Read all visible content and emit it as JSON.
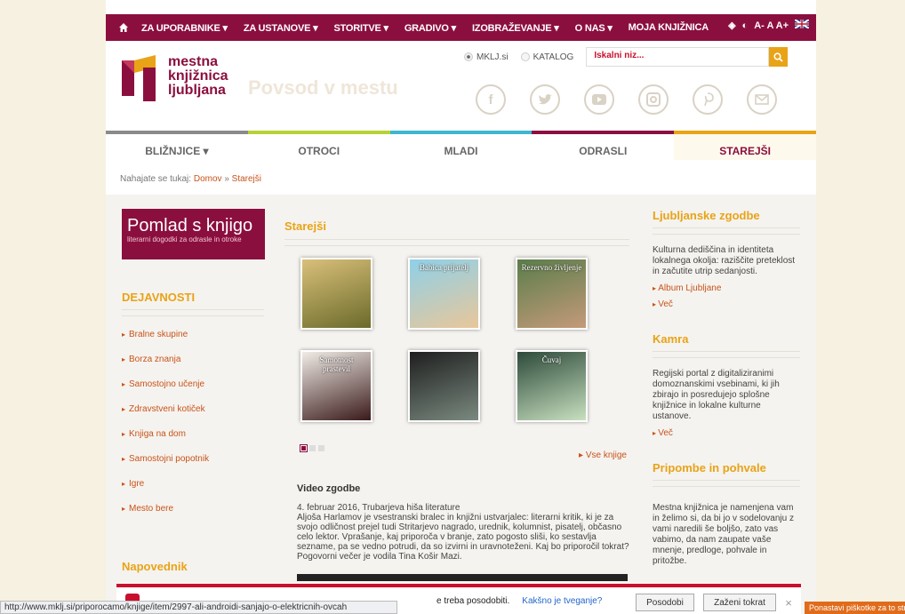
{
  "nav": {
    "items": [
      "ZA UPORABNIKE ▾",
      "ZA USTANOVE ▾",
      "STORITVE ▾",
      "GRADIVO ▾",
      "IZOBRAŽEVANJE ▾",
      "O NAS ▾",
      "MOJA KNJIŽNICA"
    ],
    "text_sizes": "A- A A+"
  },
  "logo": {
    "line1": "mestna",
    "line2": "knjižnica",
    "line3": "ljubljana"
  },
  "slogan": "Povsod v mestu",
  "search": {
    "opt1": "MKLJ.si",
    "opt2": "KATALOG",
    "placeholder": "Iskalni niz..."
  },
  "tabs": [
    {
      "label": "BLIŽNJICE ▾",
      "color": "#8a8a8a"
    },
    {
      "label": "OTROCI",
      "color": "#b5d334"
    },
    {
      "label": "MLADI",
      "color": "#3db7cf"
    },
    {
      "label": "ODRASLI",
      "color": "#8b0f3e"
    },
    {
      "label": "STAREJŠI",
      "color": "#e8a317"
    }
  ],
  "breadcrumb": {
    "prefix": "Nahajate se tukaj:",
    "home": "Domov",
    "sep": "»",
    "current": "Starejši"
  },
  "left": {
    "banner_title": "Pomlad s knjigo",
    "banner_sub": "literarni dogodki za odrasle in otroke",
    "section": "DEJAVNOSTI",
    "links": [
      "Bralne skupine",
      "Borza znanja",
      "Samostojno učenje",
      "Zdravstveni kotiček",
      "Knjiga na dom",
      "Samostojni popotnik",
      "Igre",
      "Mesto bere"
    ],
    "section2": "Napovednik"
  },
  "middle": {
    "title": "Starejši",
    "books": [
      {
        "label": "",
        "c1": "#d9c07a",
        "c2": "#6b6a2a"
      },
      {
        "label": "Babica prijatelj",
        "c1": "#8fd0e8",
        "c2": "#e8c79a"
      },
      {
        "label": "Rezervno življenje",
        "c1": "#5a7d4a",
        "c2": "#c49a7a"
      },
      {
        "label": "Samotnost prastevil",
        "c1": "#f0ece6",
        "c2": "#3a1a1a"
      },
      {
        "label": "",
        "c1": "#1e1e1e",
        "c2": "#7a8a80"
      },
      {
        "label": "Čuvaj",
        "c1": "#2d4a3a",
        "c2": "#c8e0c0"
      }
    ],
    "all_books": "Vse knjige",
    "video_title": "Video zgodbe",
    "video_date": "4. februar 2016, Trubarjeva hiša literature",
    "video_text": "Aljoša Harlamov je vsestranski bralec in knjižni ustvarjalec: literarni kritik, ki je za svojo odličnost prejel tudi Stritarjevo nagrado, urednik, kolumnist, pisatelj, občasno celo lektor. Vprašanje, kaj priporoča v branje, zato pogosto sliši, ko sestavlja sezname, pa se vedno potrudi, da so izvirni in uravnoteženi. Kaj bo priporočil tokrat? Pogovorni večer je vodila Tina Košir Mazi."
  },
  "right": {
    "h1": "Ljubljanske zgodbe",
    "p1": "Kulturna dediščina in identiteta lokalnega okolja: raziščite preteklost in začutite utrip sedanjosti.",
    "l1a": "Album Ljubljane",
    "l1b": "Več",
    "h2": "Kamra",
    "p2": "Regijski portal z digitaliziranimi domoznanskimi vsebinami, ki jih zbirajo in posredujejo splošne knjižnice in lokalne kulturne ustanove.",
    "l2": "Več",
    "h3": "Pripombe in pohvale",
    "p3": "Mestna knjižnica je namenjena vam in želimo si, da bi jo v sodelovanju z vami naredili še boljšo, zato vas vabimo, da nam zaupate vaše mnenje, predloge, pohvale in pritožbe."
  },
  "updatebar": {
    "msg": "e treba posodobiti.",
    "link": "Kakšno je tveganje?",
    "b1": "Posodobi",
    "b2": "Zaženi tokrat",
    "close": "×"
  },
  "status_url": "http://www.mklj.si/priporocamo/knjige/item/2997-ali-androidi-sanjajo-o-elektricnih-ovcah",
  "cookie": "Ponastavi piškotke za to stran"
}
